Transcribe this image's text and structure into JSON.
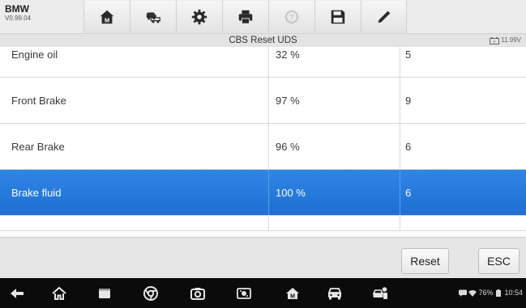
{
  "brand": {
    "name": "BMW",
    "version": "V0.99.04"
  },
  "toolbar": {
    "icons": [
      "home-icon",
      "vehicle-swap-icon",
      "settings-icon",
      "print-icon",
      "help-icon",
      "save-icon",
      "pen-icon"
    ],
    "disabled": [
      "help-icon"
    ]
  },
  "header": {
    "title": "CBS Reset UDS",
    "battery_voltage": "11.99V"
  },
  "table": {
    "rows": [
      {
        "name": "Engine oil",
        "percent": "32 %",
        "count": "5"
      },
      {
        "name": "Front Brake",
        "percent": "97 %",
        "count": "9"
      },
      {
        "name": "Rear Brake",
        "percent": "96 %",
        "count": "6"
      },
      {
        "name": "Brake fluid",
        "percent": "100 %",
        "count": "6",
        "selected": true
      }
    ]
  },
  "actions": {
    "reset_label": "Reset",
    "esc_label": "ESC"
  },
  "navbar": {
    "icons": [
      "back-icon",
      "home-icon",
      "recent-apps-icon",
      "browser-icon",
      "camera-icon",
      "screen-capture-icon",
      "autel-home-icon",
      "car-icon",
      "vci-icon"
    ],
    "status": {
      "battery_percent": "76%",
      "time": "10:54"
    }
  },
  "colors": {
    "selected_row": "#2274da",
    "toolbar_bg": "#ececec",
    "navbar_bg": "#0b0b0b"
  }
}
